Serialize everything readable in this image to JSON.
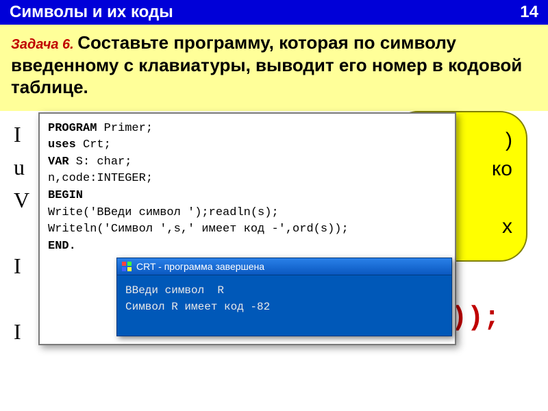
{
  "header": {
    "title": "Символы  и их коды",
    "page_number": "14"
  },
  "task": {
    "label": "Задача 6. ",
    "text": "Составьте программу, которая по символу введенному с клавиатуры, выводит его номер в кодовой таблице."
  },
  "background": {
    "left_letters": "I\nu\nV\n\nI\n\nI",
    "bubble_lines": ")\nко\n\nх",
    "paren": "));"
  },
  "code": {
    "l1_kw": "PROGRAM",
    "l1_rest": "  Primer;",
    "l2_kw": "uses",
    "l2_rest": " Crt;",
    "l3_kw": "VAR",
    "l3_rest": "   S: char;",
    "l4": "      n,code:INTEGER;",
    "l5_kw": "BEGIN",
    "l6": "     Write('ВВеди символ  ');readln(s);",
    "l7": "     Writeln('Символ ',s,' имеет код -',ord(s));",
    "l8_kw": "END."
  },
  "console": {
    "title": "CRT - программа завершена",
    "line1": "ВВеди символ  R",
    "line2": "Символ R имеет код -82"
  }
}
